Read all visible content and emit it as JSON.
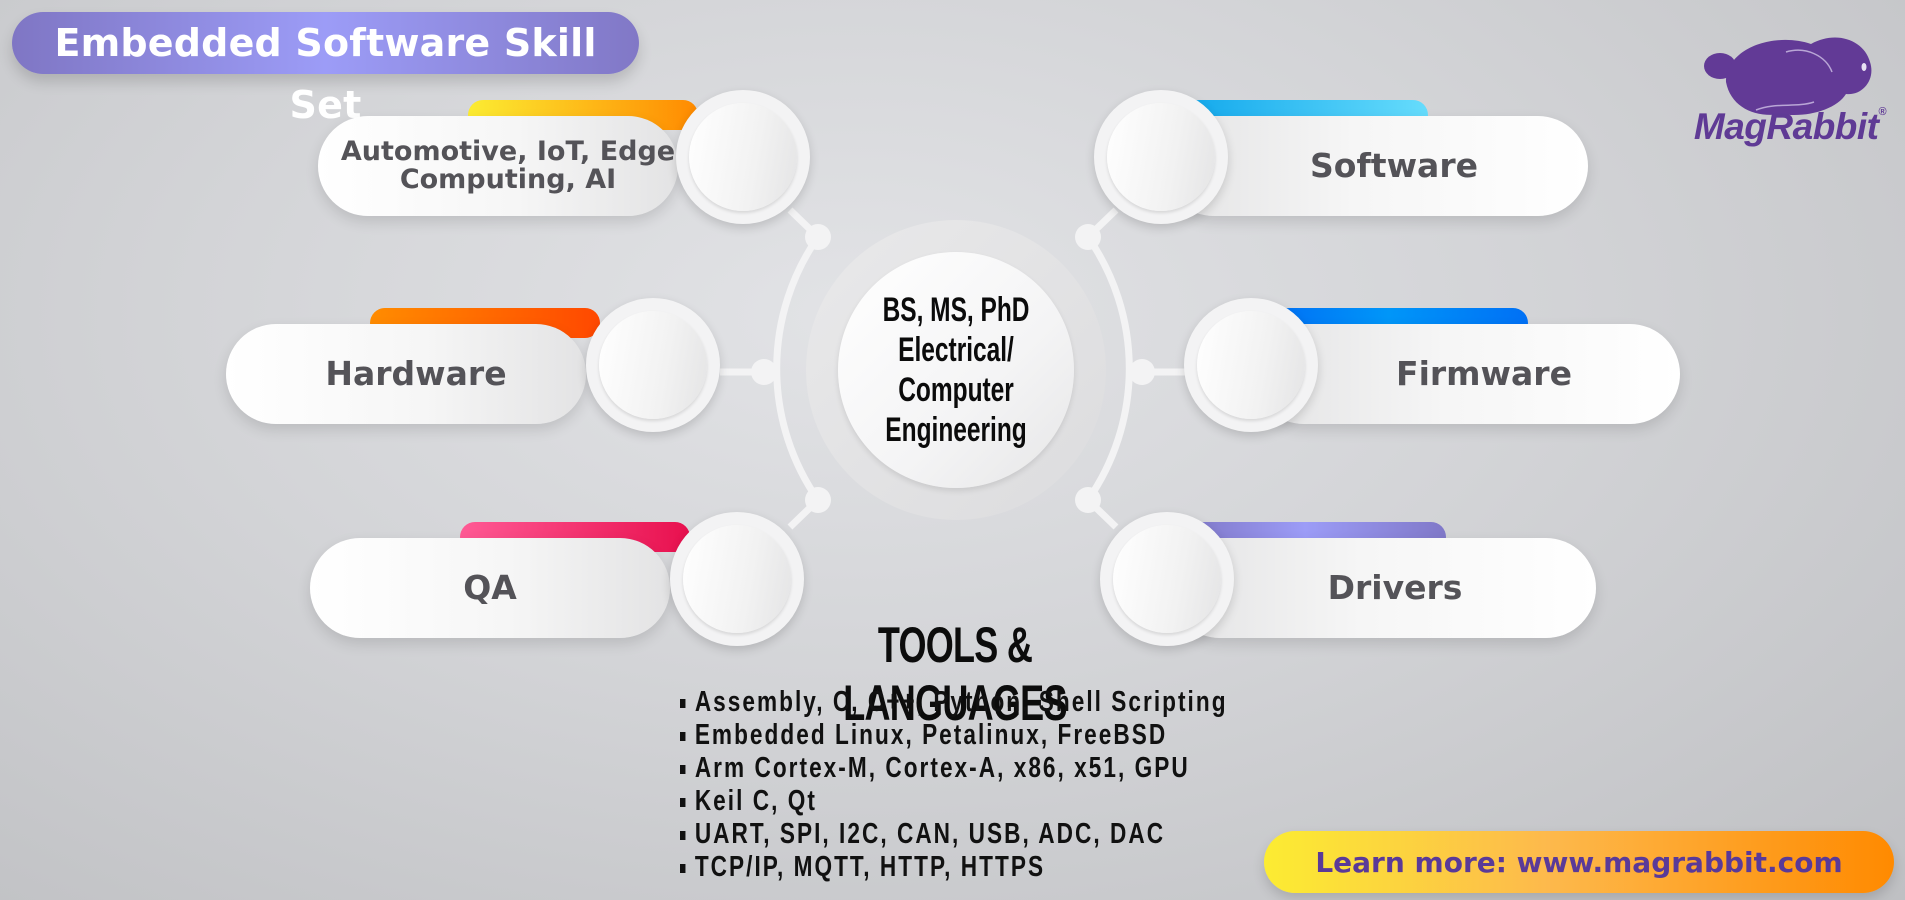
{
  "header": {
    "title": "Embedded Software Skill Set"
  },
  "brand": {
    "name": "MagRabbit",
    "registered_mark": "®",
    "logo_icon": "rabbit-logo-icon",
    "color": "#5f3a95"
  },
  "center": {
    "lines": [
      "BS, MS, PhD",
      "Electrical/",
      "Computer",
      "Engineering"
    ]
  },
  "skills": [
    {
      "id": "domains",
      "label": "Automotive, IoT, Edge Computing, AI",
      "side": "left",
      "bar_colors": [
        "#fcec32",
        "#ff8a00"
      ]
    },
    {
      "id": "hardware",
      "label": "Hardware",
      "side": "left",
      "bar_colors": [
        "#ff8c00",
        "#ff4800"
      ]
    },
    {
      "id": "qa",
      "label": "QA",
      "side": "left",
      "bar_colors": [
        "#ff5a95",
        "#e8104e"
      ]
    },
    {
      "id": "software",
      "label": "Software",
      "side": "right",
      "bar_colors": [
        "#12a8ec",
        "#66dcfc"
      ]
    },
    {
      "id": "firmware",
      "label": "Firmware",
      "side": "right",
      "bar_colors": [
        "#0070f5",
        "#0096f8"
      ]
    },
    {
      "id": "drivers",
      "label": "Drivers",
      "side": "right",
      "bar_colors": [
        "#8078c8",
        "#9c9cf7"
      ]
    }
  ],
  "tools": {
    "title": "TOOLS & LANGUAGES",
    "items": [
      "Assembly, C, C++, Python, Shell Scripting",
      "Embedded Linux, Petalinux, FreeBSD",
      "Arm Cortex-M, Cortex-A, x86, x51, GPU",
      "Keil C, Qt",
      "UART, SPI, I2C, CAN, USB, ADC, DAC",
      "TCP/IP, MQTT, HTTP, HTTPS"
    ]
  },
  "cta": {
    "label": "Learn more: www.magrabbit.com"
  }
}
